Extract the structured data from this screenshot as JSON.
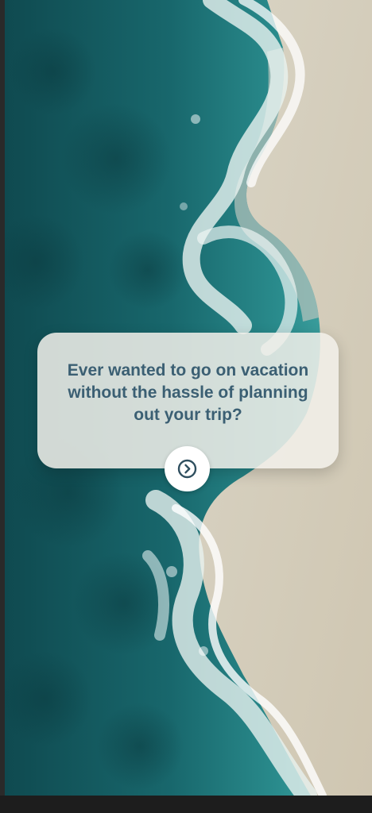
{
  "onboarding": {
    "message": "Ever wanted to go on vacation without the hassle of planning out your trip?",
    "next_button_icon": "chevron-right-circle-icon"
  },
  "colors": {
    "text": "#3b5f73",
    "ocean": "#1c6f73",
    "sand": "#d8d2c1",
    "card": "#f2f0ea"
  }
}
